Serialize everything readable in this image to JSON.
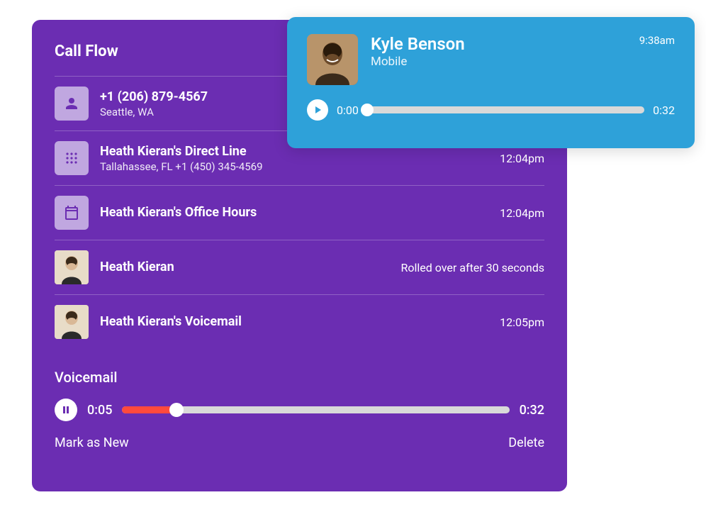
{
  "panel": {
    "title": "Call Flow",
    "rows": [
      {
        "icon": "person",
        "title": "+1 (206) 879-4567",
        "sub": "Seattle, WA",
        "time": ""
      },
      {
        "icon": "dialpad",
        "title": "Heath Kieran's Direct Line",
        "sub": "Tallahassee, FL  +1 (450) 345-4569",
        "time": "12:04pm"
      },
      {
        "icon": "calendar",
        "title": "Heath Kieran's Office Hours",
        "sub": "",
        "time": "12:04pm"
      },
      {
        "icon": "avatar",
        "title": "Heath Kieran",
        "sub": "",
        "time": "Rolled over after 30 seconds"
      },
      {
        "icon": "avatar",
        "title": "Heath Kieran's Voicemail",
        "sub": "",
        "time": "12:05pm"
      }
    ]
  },
  "voicemail": {
    "title": "Voicemail",
    "current": "0:05",
    "duration": "0:32",
    "mark_new": "Mark as New",
    "delete": "Delete"
  },
  "card": {
    "name": "Kyle Benson",
    "sub": "Mobile",
    "time": "9:38am",
    "current": "0:00",
    "duration": "0:32"
  }
}
